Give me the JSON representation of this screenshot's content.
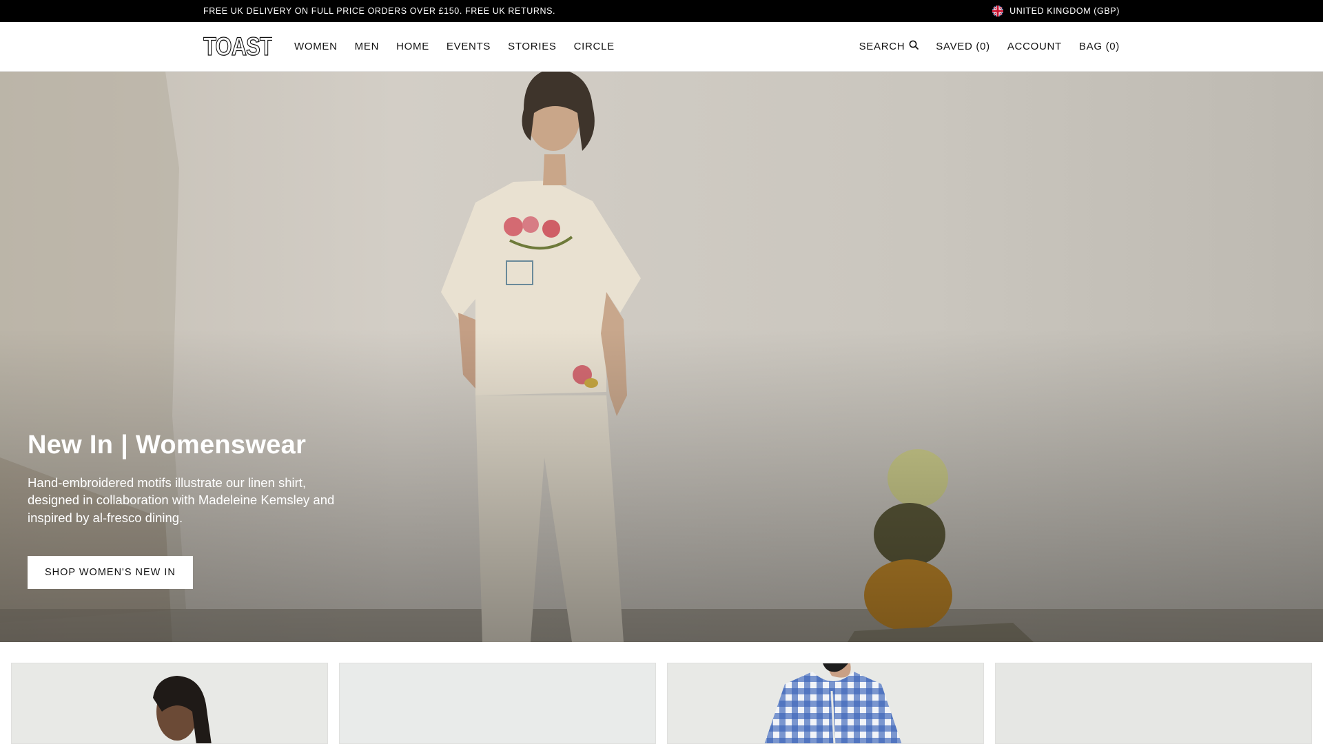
{
  "announcement": {
    "promo": "FREE UK DELIVERY ON FULL PRICE ORDERS OVER £150. FREE UK RETURNS.",
    "region": "UNITED KINGDOM (GBP)",
    "region_icon": "uk-flag-icon"
  },
  "header": {
    "logo": "TOAST",
    "nav": [
      "WOMEN",
      "MEN",
      "HOME",
      "EVENTS",
      "STORIES",
      "CIRCLE"
    ],
    "utility": {
      "search": "SEARCH",
      "search_icon": "search-icon",
      "saved": "SAVED (0)",
      "account": "ACCOUNT",
      "bag": "BAG (0)"
    }
  },
  "hero": {
    "title": "New In | Womenswear",
    "text": "Hand-embroidered motifs illustrate our linen shirt, designed in collaboration with Madeleine Kemsley and inspired by al-fresco dining.",
    "cta": "SHOP WOMEN'S NEW IN"
  },
  "tiles": [
    {
      "name": "product-tile-1"
    },
    {
      "name": "product-tile-2"
    },
    {
      "name": "product-tile-3"
    },
    {
      "name": "product-tile-4"
    }
  ],
  "colors": {
    "announcement_bg": "#000000",
    "text": "#111111",
    "hero_bg": "#c9c5bc",
    "tile_bg": "#e7e8e6"
  }
}
